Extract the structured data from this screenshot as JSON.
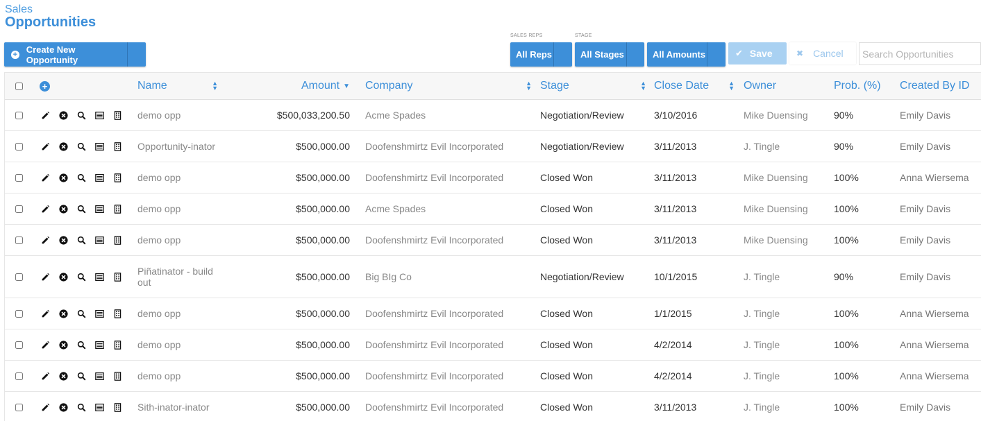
{
  "header": {
    "section": "Sales",
    "title": "Opportunities"
  },
  "toolbar": {
    "create_label": "Create New Opportunity",
    "filters": [
      {
        "label": "SALES REPS",
        "value": "All Reps"
      },
      {
        "label": "STAGE",
        "value": "All Stages"
      },
      {
        "label": "",
        "value": "All Amounts"
      }
    ],
    "save_label": "Save",
    "cancel_label": "Cancel",
    "search_placeholder": "Search Opportunities"
  },
  "table": {
    "columns": {
      "name": "Name",
      "amount": "Amount",
      "company": "Company",
      "stage": "Stage",
      "close_date": "Close Date",
      "owner": "Owner",
      "prob": "Prob. (%)",
      "created_by": "Created By ID"
    },
    "rows": [
      {
        "name": "demo opp",
        "amount": "$500,033,200.50",
        "company": "Acme Spades",
        "stage": "Negotiation/Review",
        "close_date": "3/10/2016",
        "owner": "Mike Duensing",
        "prob": "90%",
        "created_by": "Emily Davis"
      },
      {
        "name": "Opportunity-inator",
        "amount": "$500,000.00",
        "company": "Doofenshmirtz Evil Incorporated",
        "stage": "Negotiation/Review",
        "close_date": "3/11/2013",
        "owner": "J. Tingle",
        "prob": "90%",
        "created_by": "Emily Davis"
      },
      {
        "name": "demo opp",
        "amount": "$500,000.00",
        "company": "Doofenshmirtz Evil Incorporated",
        "stage": "Closed Won",
        "close_date": "3/11/2013",
        "owner": "Mike Duensing",
        "prob": "100%",
        "created_by": "Anna Wiersema"
      },
      {
        "name": "demo opp",
        "amount": "$500,000.00",
        "company": "Acme Spades",
        "stage": "Closed Won",
        "close_date": "3/11/2013",
        "owner": "Mike Duensing",
        "prob": "100%",
        "created_by": "Emily Davis"
      },
      {
        "name": "demo opp",
        "amount": "$500,000.00",
        "company": "Doofenshmirtz Evil Incorporated",
        "stage": "Closed Won",
        "close_date": "3/11/2013",
        "owner": "Mike Duensing",
        "prob": "100%",
        "created_by": "Emily Davis"
      },
      {
        "name": "Piñatinator - build out",
        "amount": "$500,000.00",
        "company": "Big BIg Co",
        "stage": "Negotiation/Review",
        "close_date": "10/1/2015",
        "owner": "J. Tingle",
        "prob": "90%",
        "created_by": "Emily Davis"
      },
      {
        "name": "demo opp",
        "amount": "$500,000.00",
        "company": "Doofenshmirtz Evil Incorporated",
        "stage": "Closed Won",
        "close_date": "1/1/2015",
        "owner": "J. Tingle",
        "prob": "100%",
        "created_by": "Anna Wiersema"
      },
      {
        "name": "demo opp",
        "amount": "$500,000.00",
        "company": "Doofenshmirtz Evil Incorporated",
        "stage": "Closed Won",
        "close_date": "4/2/2014",
        "owner": "J. Tingle",
        "prob": "100%",
        "created_by": "Anna Wiersema"
      },
      {
        "name": "demo opp",
        "amount": "$500,000.00",
        "company": "Doofenshmirtz Evil Incorporated",
        "stage": "Closed Won",
        "close_date": "4/2/2014",
        "owner": "J. Tingle",
        "prob": "100%",
        "created_by": "Anna Wiersema"
      },
      {
        "name": "Sith-inator-inator",
        "amount": "$500,000.00",
        "company": "Doofenshmirtz Evil Incorporated",
        "stage": "Closed Won",
        "close_date": "3/11/2013",
        "owner": "J. Tingle",
        "prob": "100%",
        "created_by": "Emily Davis"
      }
    ]
  },
  "row_icons": [
    "pencil-icon",
    "close-circle-icon",
    "search-icon",
    "card-icon",
    "building-icon"
  ],
  "colors": {
    "accent": "#3d8fd9",
    "save_disabled": "#a9d1f2"
  }
}
